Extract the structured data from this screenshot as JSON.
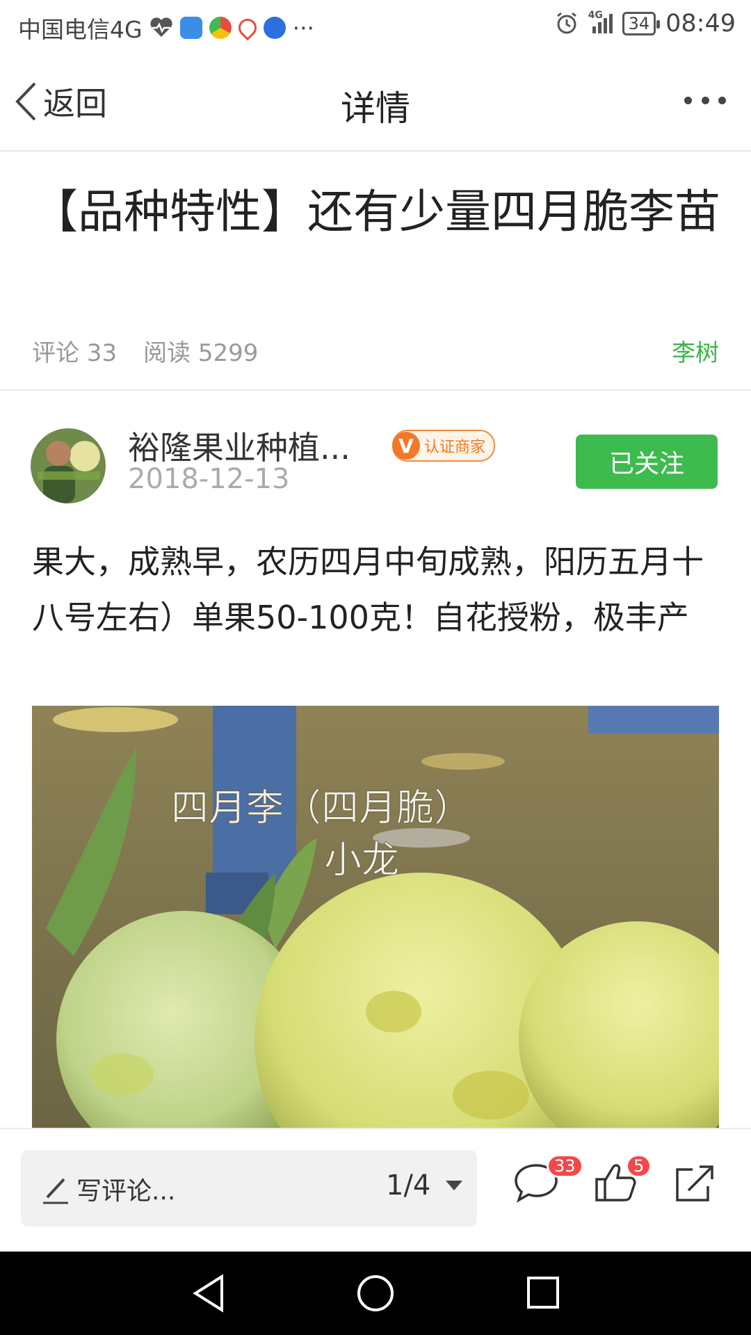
{
  "status_bar": {
    "carrier": "中国电信4G",
    "time": "08:49",
    "battery": "34",
    "network": "4G",
    "overflow": "···",
    "icons": [
      "heart-pulse-icon",
      "shield-app-icon",
      "browser-app-icon",
      "map-app-icon",
      "baidu-app-icon",
      "alarm-icon",
      "signal-icon",
      "battery-icon"
    ]
  },
  "nav": {
    "back_label": "返回",
    "title": "详情"
  },
  "article": {
    "title": "【品种特性】还有少量四月脆李苗",
    "comments_label": "评论 33",
    "reads_label": "阅读 5299",
    "tag": "李树"
  },
  "author": {
    "name": "裕隆果业种植...",
    "badge_letter": "V",
    "badge_label": "认证商家",
    "date": "2018-12-13",
    "follow_label": "已关注"
  },
  "body": {
    "text": "果大，成熟早，农历四月中旬成熟，阳历五月十八号左右）单果50-100克！自花授粉，极丰产"
  },
  "image": {
    "overlay_line1": "四月李（四月脆）",
    "overlay_line2": "小龙"
  },
  "bottom_bar": {
    "comment_placeholder": "写评论...",
    "page_indicator": "1/4",
    "comment_count": "33",
    "like_count": "5"
  },
  "colors": {
    "accent_green": "#3dbb4f",
    "tag_green": "#3cb34a",
    "badge_orange": "#f2782a",
    "count_red": "#f4474a"
  }
}
